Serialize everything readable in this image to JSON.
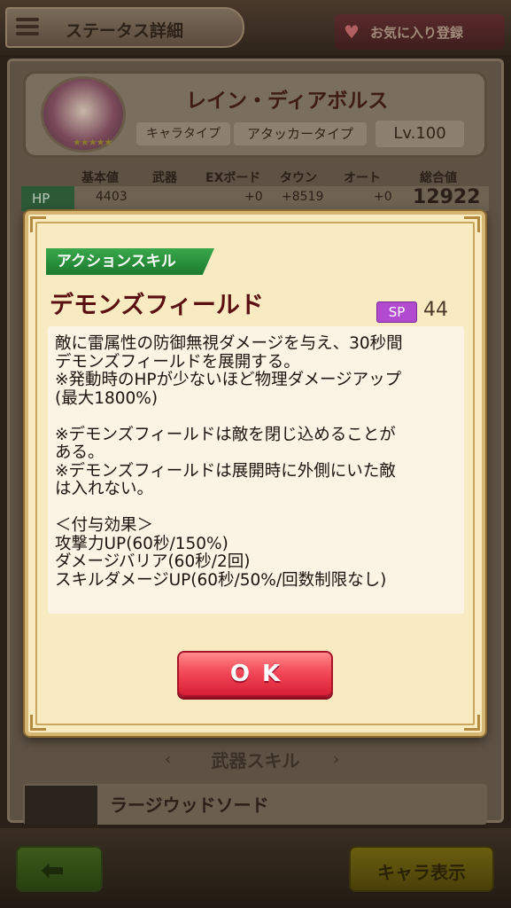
{
  "header": {
    "title": "ステータス詳細",
    "favorite_label": "お気に入り登録"
  },
  "character": {
    "name": "レイン・ディアボルス",
    "type_label": "キャラタイプ",
    "type_value": "アタッカータイプ",
    "level": "Lv.100",
    "stars": "★★★★★"
  },
  "stats": {
    "headers": [
      "基本値",
      "武器",
      "EXボード",
      "タウン",
      "オート",
      "総合値"
    ],
    "hp_label": "HP",
    "hp_values": [
      "4403",
      "",
      "+0",
      "+8519",
      "+0"
    ],
    "hp_total": "12922"
  },
  "modal": {
    "tag": "アクションスキル",
    "skill_name": "デモンズフィールド",
    "sp_label": "SP",
    "sp_value": "44",
    "description": [
      "敵に雷属性の防御無視ダメージを与え、30秒間",
      "デモンズフィールドを展開する。",
      "※発動時のHPが少ないほど物理ダメージアップ",
      "(最大1800%)",
      "",
      "※デモンズフィールドは敵を閉じ込めることが",
      "ある。",
      "※デモンズフィールドは展開時に外側にいた敵",
      "は入れない。",
      "",
      "＜付与効果＞",
      "攻撃力UP(60秒/150%)",
      "ダメージバリア(60秒/2回)",
      "スキルダメージUP(60秒/50%/回数制限なし)"
    ],
    "ok_label": "OK"
  },
  "weapon": {
    "section_title": "武器スキル",
    "name": "ラージウッドソード"
  },
  "footer": {
    "chara_display_label": "キャラ表示"
  },
  "colors": {
    "ok_button": "#f34a58",
    "skill_tag": "#2a9a3c",
    "sp_badge": "#b24ad0",
    "skill_name": "#5a1010"
  }
}
